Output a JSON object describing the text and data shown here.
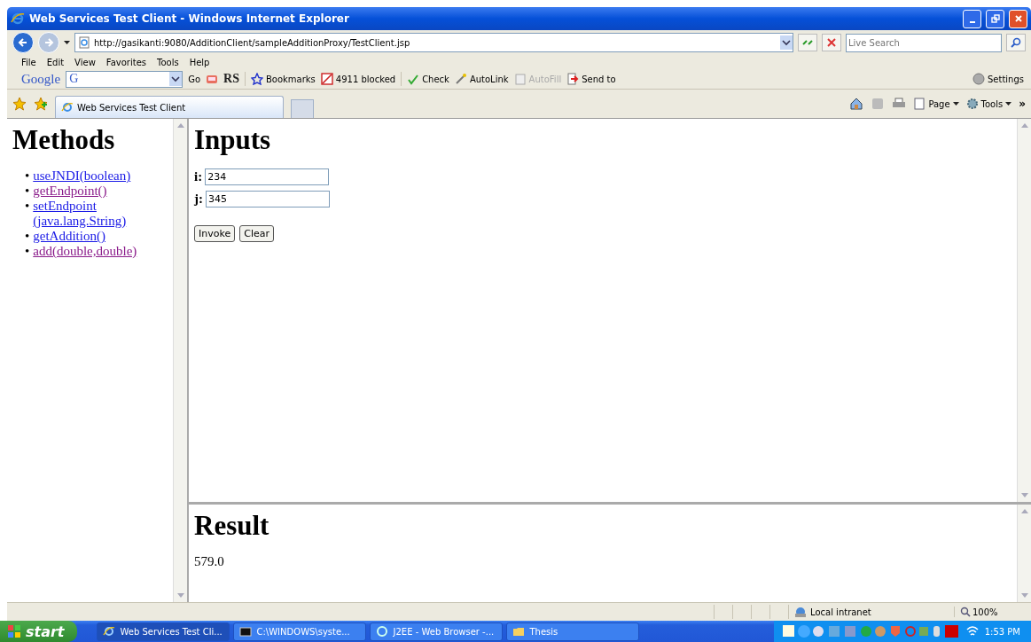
{
  "window": {
    "title": "Web Services Test Client - Windows Internet Explorer"
  },
  "address_bar": {
    "url": "http://gasikanti:9080/AdditionClient/sampleAdditionProxy/TestClient.jsp",
    "search_placeholder": "Live Search"
  },
  "menu": [
    "File",
    "Edit",
    "View",
    "Favorites",
    "Tools",
    "Help"
  ],
  "google_toolbar": {
    "logo": "Google",
    "search_logo": "G",
    "go": "Go",
    "items": [
      {
        "label": "RS",
        "kind": "rs",
        "disabled": false
      },
      {
        "label": "Bookmarks",
        "kind": "bookmarks",
        "disabled": false
      },
      {
        "label": "4911 blocked",
        "kind": "blocked",
        "disabled": false
      },
      {
        "label": "Check",
        "kind": "check",
        "disabled": false
      },
      {
        "label": "AutoLink",
        "kind": "autolink",
        "disabled": false
      },
      {
        "label": "AutoFill",
        "kind": "autofill",
        "disabled": true
      },
      {
        "label": "Send to",
        "kind": "sendto",
        "disabled": false
      }
    ],
    "settings": "Settings"
  },
  "tabs": [
    {
      "label": "Web Services Test Client",
      "selected": true
    }
  ],
  "command_bar": {
    "items": [
      "Page",
      "Tools"
    ],
    "chevron": "»"
  },
  "methods": {
    "title": "Methods",
    "marker": "•",
    "links": [
      {
        "label": "useJNDI(boolean)",
        "visited": false
      },
      {
        "label": "getEndpoint()",
        "visited": true
      },
      {
        "label": "setEndpoint (java.lang.String)",
        "visited": false
      },
      {
        "label": "getAddition()",
        "visited": false
      },
      {
        "label": "add(double,double)",
        "visited": true
      }
    ]
  },
  "inputs": {
    "title": "Inputs",
    "fields": [
      {
        "label": "i:",
        "value": "234"
      },
      {
        "label": "j:",
        "value": "345"
      }
    ],
    "buttons": [
      "Invoke",
      "Clear"
    ]
  },
  "result": {
    "title": "Result",
    "value": "579.0"
  },
  "status_bar": {
    "zone": "Local intranet",
    "zoom": "100%"
  },
  "taskbar": {
    "start": "start",
    "items": [
      {
        "label": "Web Services Test Cli...",
        "kind": "ie",
        "selected": true
      },
      {
        "label": "C:\\WINDOWS\\syste...",
        "kind": "console",
        "selected": false
      },
      {
        "label": "J2EE - Web Browser -...",
        "kind": "j2ee",
        "selected": false
      },
      {
        "label": "Thesis",
        "kind": "folder",
        "selected": false
      }
    ],
    "clock": "1:53 PM"
  }
}
